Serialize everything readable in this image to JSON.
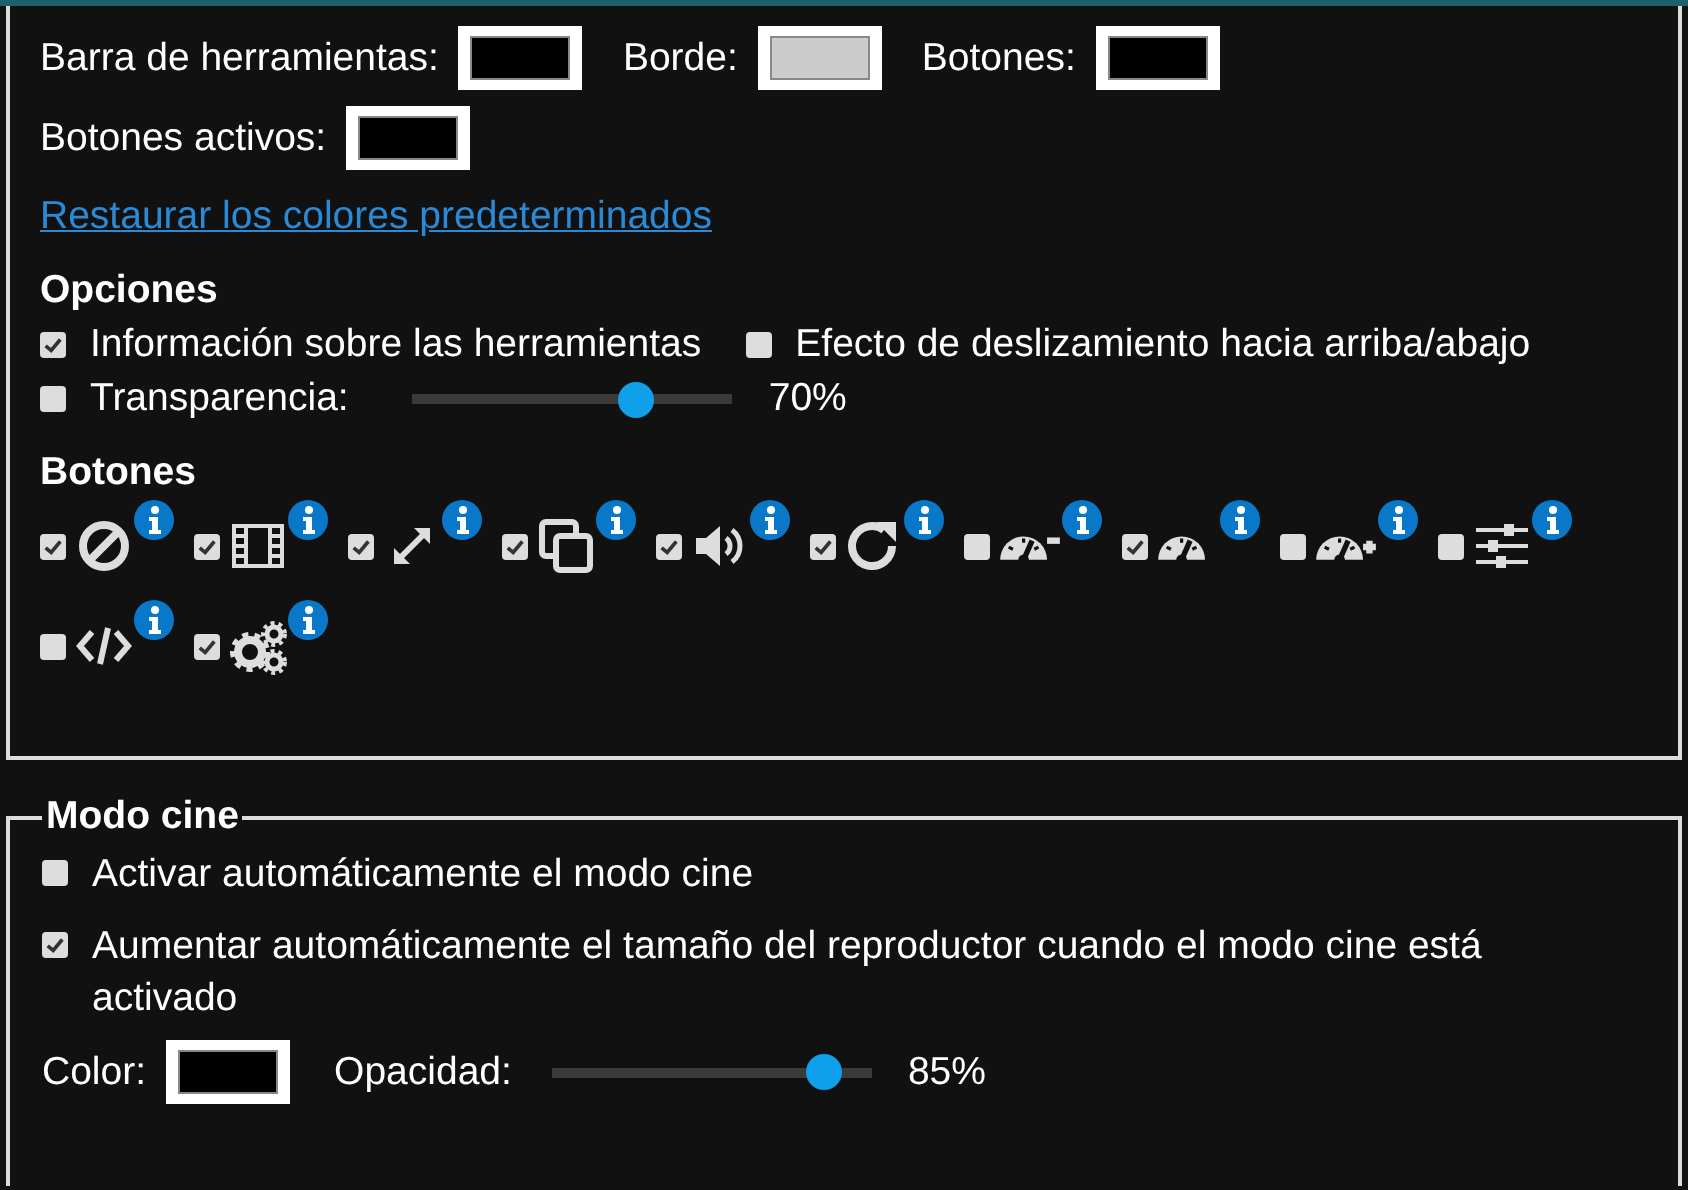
{
  "toolbar_colors": [
    {
      "label": "Barra de herramientas:",
      "color": "#000000"
    },
    {
      "label": "Borde:",
      "color": "#cccccc"
    },
    {
      "label": "Botones:",
      "color": "#000000"
    },
    {
      "label": "Botones activos:",
      "color": "#000000"
    }
  ],
  "restore_link": "Restaurar los colores predeterminados",
  "options": {
    "heading": "Opciones",
    "items": [
      {
        "kind": "checkbox",
        "label": "Información sobre las herramientas",
        "checked": true
      },
      {
        "kind": "checkbox",
        "label": "Efecto de deslizamiento hacia arriba/abajo",
        "checked": false
      },
      {
        "kind": "slider",
        "label": "Transparencia:",
        "checked": false,
        "level": 0.7,
        "reading": "70%"
      }
    ]
  },
  "buttons": {
    "heading": "Botones",
    "items": [
      {
        "kind": "ban",
        "checked": true
      },
      {
        "kind": "film",
        "checked": true
      },
      {
        "kind": "expand",
        "checked": true
      },
      {
        "kind": "copy",
        "checked": true
      },
      {
        "kind": "volume",
        "checked": true
      },
      {
        "kind": "redo",
        "checked": true
      },
      {
        "kind": "speed-minus",
        "checked": false
      },
      {
        "kind": "speed",
        "checked": true
      },
      {
        "kind": "speed-plus",
        "checked": false
      },
      {
        "kind": "sliders",
        "checked": false
      },
      {
        "kind": "code",
        "checked": false
      },
      {
        "kind": "gears",
        "checked": true
      }
    ]
  },
  "cinema_mode": {
    "legend": "Modo cine",
    "options": [
      {
        "label": "Activar automáticamente el modo cine",
        "checked": false
      },
      {
        "label": "Aumentar automáticamente el tamaño del reproductor cuando el modo cine está activado",
        "checked": true
      }
    ],
    "color": {
      "label": "Color:",
      "color": "#000000"
    },
    "opacity": {
      "label": "Opacidad:",
      "level": 0.85,
      "reading": "85%"
    }
  }
}
